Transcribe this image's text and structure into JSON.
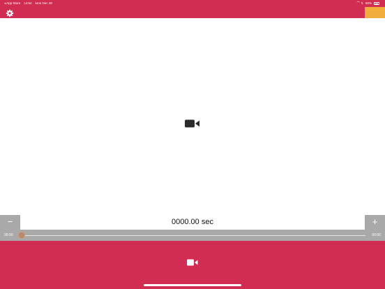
{
  "status_bar": {
    "back_app": "◂ App Store",
    "time": "14:54",
    "date": "Mon Dec 28",
    "signal_icons": "⌒ ↯",
    "battery_percent": "60%"
  },
  "top_bar": {
    "settings_icon": "gear-icon",
    "accent_color": "#f2ae3d"
  },
  "preview": {
    "placeholder_icon": "video-camera-icon"
  },
  "timer": {
    "minus_label": "−",
    "plus_label": "+",
    "display": "0000.00 sec"
  },
  "scrubber": {
    "start_time": "00:00",
    "end_time": "00:00",
    "position": 0
  },
  "bottom_bar": {
    "record_icon": "video-camera-icon"
  },
  "colors": {
    "brand": "#d12c52",
    "scrubber_bg": "#a9a9a9",
    "accent": "#f2ae3d"
  }
}
